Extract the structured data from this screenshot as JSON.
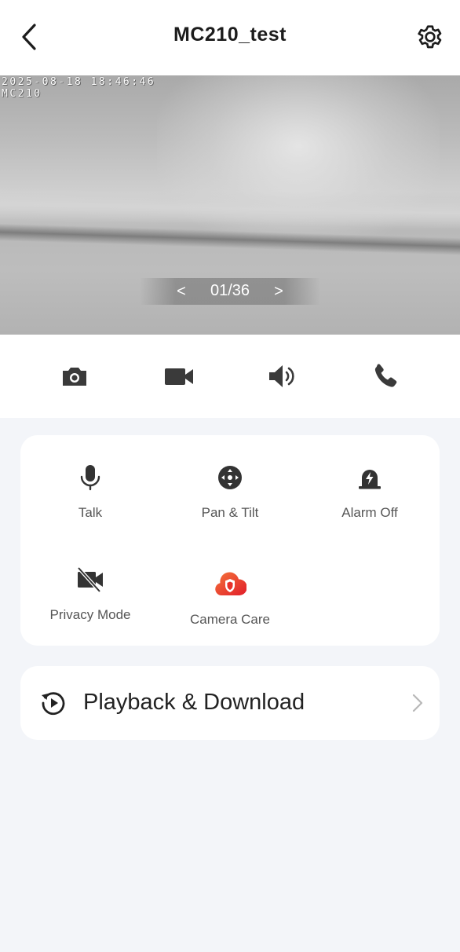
{
  "header": {
    "title": "MC210_test",
    "back_icon": "chevron-left-icon",
    "settings_icon": "gear-icon"
  },
  "video": {
    "osd_timestamp": "2025-08-18 18:46:46",
    "osd_camera_name": "MC210",
    "pager": {
      "prev_label": "<",
      "count": "01/36",
      "next_label": ">"
    }
  },
  "toolbar": {
    "items": [
      {
        "icon": "camera-snapshot-icon"
      },
      {
        "icon": "video-record-icon"
      },
      {
        "icon": "speaker-icon"
      },
      {
        "icon": "phone-call-icon"
      }
    ]
  },
  "controls": {
    "items": [
      {
        "label": "Talk",
        "icon": "microphone-icon"
      },
      {
        "label": "Pan & Tilt",
        "icon": "pan-tilt-icon"
      },
      {
        "label": "Alarm Off",
        "icon": "alarm-icon"
      },
      {
        "label": "Privacy Mode",
        "icon": "privacy-mode-icon"
      },
      {
        "label": "Camera Care",
        "icon": "camera-care-icon"
      }
    ]
  },
  "playback": {
    "label": "Playback & Download",
    "icon": "playback-icon",
    "chevron": "chevron-right-icon"
  },
  "colors": {
    "background": "#f3f5f9",
    "card": "#ffffff",
    "icon": "#333333",
    "camera_care_accent": "#e8302a"
  }
}
